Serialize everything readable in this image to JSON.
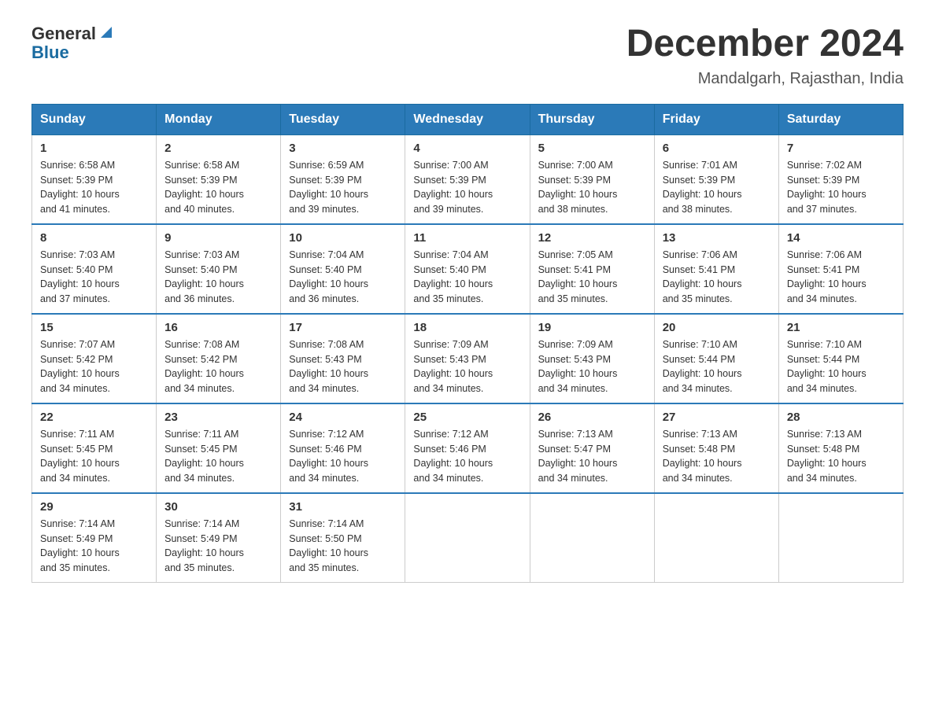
{
  "logo": {
    "general": "General",
    "blue": "Blue"
  },
  "title": "December 2024",
  "location": "Mandalgarh, Rajasthan, India",
  "days_of_week": [
    "Sunday",
    "Monday",
    "Tuesday",
    "Wednesday",
    "Thursday",
    "Friday",
    "Saturday"
  ],
  "weeks": [
    [
      {
        "day": "1",
        "info": "Sunrise: 6:58 AM\nSunset: 5:39 PM\nDaylight: 10 hours\nand 41 minutes."
      },
      {
        "day": "2",
        "info": "Sunrise: 6:58 AM\nSunset: 5:39 PM\nDaylight: 10 hours\nand 40 minutes."
      },
      {
        "day": "3",
        "info": "Sunrise: 6:59 AM\nSunset: 5:39 PM\nDaylight: 10 hours\nand 39 minutes."
      },
      {
        "day": "4",
        "info": "Sunrise: 7:00 AM\nSunset: 5:39 PM\nDaylight: 10 hours\nand 39 minutes."
      },
      {
        "day": "5",
        "info": "Sunrise: 7:00 AM\nSunset: 5:39 PM\nDaylight: 10 hours\nand 38 minutes."
      },
      {
        "day": "6",
        "info": "Sunrise: 7:01 AM\nSunset: 5:39 PM\nDaylight: 10 hours\nand 38 minutes."
      },
      {
        "day": "7",
        "info": "Sunrise: 7:02 AM\nSunset: 5:39 PM\nDaylight: 10 hours\nand 37 minutes."
      }
    ],
    [
      {
        "day": "8",
        "info": "Sunrise: 7:03 AM\nSunset: 5:40 PM\nDaylight: 10 hours\nand 37 minutes."
      },
      {
        "day": "9",
        "info": "Sunrise: 7:03 AM\nSunset: 5:40 PM\nDaylight: 10 hours\nand 36 minutes."
      },
      {
        "day": "10",
        "info": "Sunrise: 7:04 AM\nSunset: 5:40 PM\nDaylight: 10 hours\nand 36 minutes."
      },
      {
        "day": "11",
        "info": "Sunrise: 7:04 AM\nSunset: 5:40 PM\nDaylight: 10 hours\nand 35 minutes."
      },
      {
        "day": "12",
        "info": "Sunrise: 7:05 AM\nSunset: 5:41 PM\nDaylight: 10 hours\nand 35 minutes."
      },
      {
        "day": "13",
        "info": "Sunrise: 7:06 AM\nSunset: 5:41 PM\nDaylight: 10 hours\nand 35 minutes."
      },
      {
        "day": "14",
        "info": "Sunrise: 7:06 AM\nSunset: 5:41 PM\nDaylight: 10 hours\nand 34 minutes."
      }
    ],
    [
      {
        "day": "15",
        "info": "Sunrise: 7:07 AM\nSunset: 5:42 PM\nDaylight: 10 hours\nand 34 minutes."
      },
      {
        "day": "16",
        "info": "Sunrise: 7:08 AM\nSunset: 5:42 PM\nDaylight: 10 hours\nand 34 minutes."
      },
      {
        "day": "17",
        "info": "Sunrise: 7:08 AM\nSunset: 5:43 PM\nDaylight: 10 hours\nand 34 minutes."
      },
      {
        "day": "18",
        "info": "Sunrise: 7:09 AM\nSunset: 5:43 PM\nDaylight: 10 hours\nand 34 minutes."
      },
      {
        "day": "19",
        "info": "Sunrise: 7:09 AM\nSunset: 5:43 PM\nDaylight: 10 hours\nand 34 minutes."
      },
      {
        "day": "20",
        "info": "Sunrise: 7:10 AM\nSunset: 5:44 PM\nDaylight: 10 hours\nand 34 minutes."
      },
      {
        "day": "21",
        "info": "Sunrise: 7:10 AM\nSunset: 5:44 PM\nDaylight: 10 hours\nand 34 minutes."
      }
    ],
    [
      {
        "day": "22",
        "info": "Sunrise: 7:11 AM\nSunset: 5:45 PM\nDaylight: 10 hours\nand 34 minutes."
      },
      {
        "day": "23",
        "info": "Sunrise: 7:11 AM\nSunset: 5:45 PM\nDaylight: 10 hours\nand 34 minutes."
      },
      {
        "day": "24",
        "info": "Sunrise: 7:12 AM\nSunset: 5:46 PM\nDaylight: 10 hours\nand 34 minutes."
      },
      {
        "day": "25",
        "info": "Sunrise: 7:12 AM\nSunset: 5:46 PM\nDaylight: 10 hours\nand 34 minutes."
      },
      {
        "day": "26",
        "info": "Sunrise: 7:13 AM\nSunset: 5:47 PM\nDaylight: 10 hours\nand 34 minutes."
      },
      {
        "day": "27",
        "info": "Sunrise: 7:13 AM\nSunset: 5:48 PM\nDaylight: 10 hours\nand 34 minutes."
      },
      {
        "day": "28",
        "info": "Sunrise: 7:13 AM\nSunset: 5:48 PM\nDaylight: 10 hours\nand 34 minutes."
      }
    ],
    [
      {
        "day": "29",
        "info": "Sunrise: 7:14 AM\nSunset: 5:49 PM\nDaylight: 10 hours\nand 35 minutes."
      },
      {
        "day": "30",
        "info": "Sunrise: 7:14 AM\nSunset: 5:49 PM\nDaylight: 10 hours\nand 35 minutes."
      },
      {
        "day": "31",
        "info": "Sunrise: 7:14 AM\nSunset: 5:50 PM\nDaylight: 10 hours\nand 35 minutes."
      },
      {
        "day": "",
        "info": ""
      },
      {
        "day": "",
        "info": ""
      },
      {
        "day": "",
        "info": ""
      },
      {
        "day": "",
        "info": ""
      }
    ]
  ]
}
